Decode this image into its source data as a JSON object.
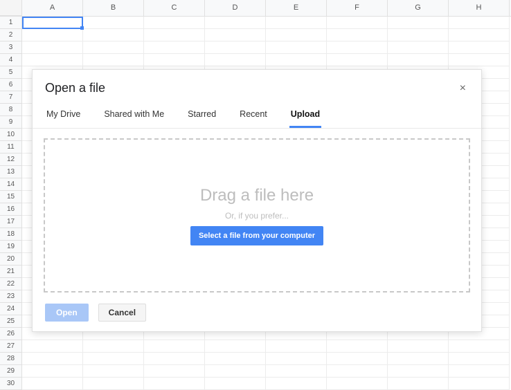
{
  "spreadsheet": {
    "columns": [
      "A",
      "B",
      "C",
      "D",
      "E",
      "F",
      "G",
      "H"
    ],
    "first_row": 1,
    "last_row": 30,
    "selected_cell": "A1"
  },
  "dialog": {
    "title": "Open a file",
    "close_label": "×",
    "tabs": {
      "my_drive": "My Drive",
      "shared": "Shared with Me",
      "starred": "Starred",
      "recent": "Recent",
      "upload": "Upload"
    },
    "active_tab": "upload",
    "upload": {
      "drag_text": "Drag a file here",
      "or_text": "Or, if you prefer...",
      "select_button": "Select a file from your computer"
    },
    "footer": {
      "open": "Open",
      "cancel": "Cancel"
    }
  }
}
